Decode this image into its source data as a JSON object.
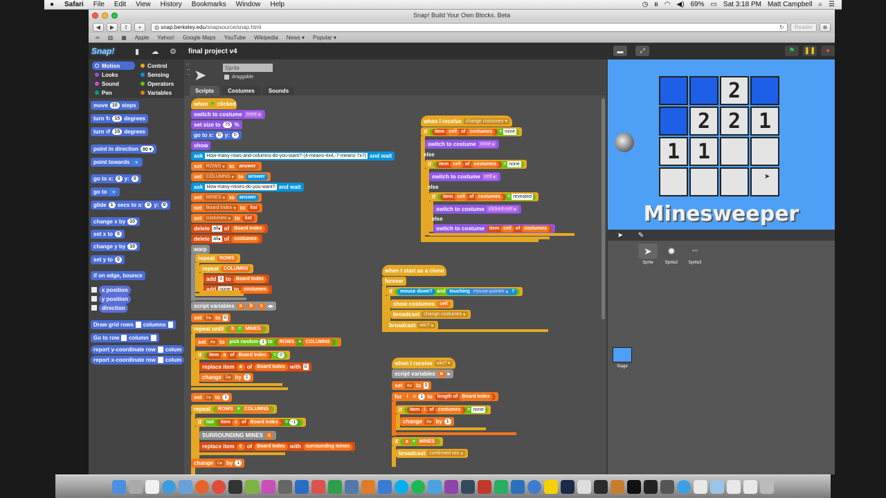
{
  "menubar": {
    "apple": "",
    "app": "Safari",
    "items": [
      "File",
      "Edit",
      "View",
      "History",
      "Bookmarks",
      "Window",
      "Help"
    ],
    "battery": "69%",
    "clock": "Sat 3:18 PM",
    "user": "Matt Campbell"
  },
  "window": {
    "title": "Snap! Build Your Own Blocks. Beta",
    "url_host": "snap.berkeley.edu",
    "url_path": "/snapsource/snap.html",
    "reader": "Reader",
    "bookmarks": [
      "Apple",
      "Yahoo!",
      "Google Maps",
      "YouTube",
      "Wikipedia",
      "News ▾",
      "Popular ▾"
    ]
  },
  "snap": {
    "logo": "Snap!",
    "project_title": "final project v4",
    "categories": [
      {
        "label": "Motion",
        "color": "#4a6cd4"
      },
      {
        "label": "Control",
        "color": "#e6a822"
      },
      {
        "label": "Looks",
        "color": "#8f56e3"
      },
      {
        "label": "Sensing",
        "color": "#0494dc"
      },
      {
        "label": "Sound",
        "color": "#cf4ad9"
      },
      {
        "label": "Operators",
        "color": "#62c213"
      },
      {
        "label": "Pen",
        "color": "#00a178"
      },
      {
        "label": "Variables",
        "color": "#f3761d"
      }
    ],
    "palette": {
      "move": "move",
      "move_n": "10",
      "steps": "steps",
      "turn_cw": "turn ↻",
      "turn_ccw": "turn ↺",
      "turn_n": "15",
      "degrees": "degrees",
      "point_dir": "point in direction",
      "point_dir_n": "90 ▾",
      "point_towards": "point towards",
      "goto_xy": "go to x:",
      "y": "y:",
      "zero": "0",
      "goto": "go to",
      "glide": "glide",
      "glide_n": "1",
      "secs_to_x": "secs to x:",
      "change_x": "change x by",
      "set_x": "set x to",
      "change_y": "change y by",
      "set_y": "set y to",
      "ten": "10",
      "bounce": "if on edge, bounce",
      "x_pos": "x position",
      "y_pos": "y position",
      "direction": "direction",
      "draw_grid": "Draw grid rows",
      "columns": "columns",
      "goto_row": "Go to row",
      "column": "column",
      "report_y": "report y-coordinate row",
      "report_x": "report x-coordinate row",
      "colum": "colum"
    },
    "sprite": {
      "name": "Sprite",
      "draggable": "draggable",
      "tabs": [
        "Scripts",
        "Costumes",
        "Sounds"
      ]
    },
    "script1": {
      "hat": "when",
      "hat2": "clicked",
      "switch_costume": "switch to costume",
      "mine": "mine",
      "set_size": "set size to",
      "size_n": "75",
      "pct": "%",
      "goto_x": "go to x:",
      "go_y": "y:",
      "zero": "0",
      "show": "show",
      "ask": "ask",
      "ask_rows": "How-many-rows-and-columns-do-you-want?-(4-means-4x4,-7-means-7x7)",
      "and_wait": "and wait",
      "set": "set",
      "to": "to",
      "rows": "ROWS",
      "columns": "COLUMNS",
      "mines": "MINES",
      "answer": "answer",
      "ask_mines": "How-many-mines-do-you-want?",
      "board_index": "Board Index",
      "costumes": "costumes",
      "list": "list",
      "delete": "delete",
      "all": "all",
      "of": "of",
      "warp": "warp",
      "repeat": "repeat",
      "add": "add",
      "add_zero": "0",
      "none": "none",
      "script_vars": "script variables",
      "a": "a",
      "b": "b",
      "c": "c",
      "repeat_until": "repeat until",
      "eq": "=",
      "pick_random": "pick random",
      "one": "1",
      "x": "×",
      "if": "if",
      "item": "item",
      "replace_item": "replace item",
      "with": "with",
      "zero_b": "0",
      "change": "change",
      "by": "by",
      "not": "not",
      "neg_one": "-1",
      "surrounding_mines": "SURROUNDING MINES",
      "surrounding_mines_l": "surrounding mines"
    },
    "script2": {
      "hat": "when I receive",
      "msg": "change costumes",
      "if": "if",
      "item": "item",
      "cell": "cell",
      "of": "of",
      "costumes": "costumes",
      "eq": "=",
      "mine": "mine",
      "else": "else",
      "switch": "switch to costume",
      "none": "none",
      "revealed": "revealed",
      "clicked_cell": "clicked-cell"
    },
    "script3": {
      "hat": "when I start as a clone",
      "forever": "forever",
      "if": "if",
      "mouse_down": "mouse down?",
      "and": "and",
      "touching": "touching",
      "mouse_pointer": "mouse-pointer",
      "q": "?",
      "show_costumes": "show costumes",
      "cell": "cell",
      "broadcast": "broadcast",
      "change_costumes": "change costumes",
      "win": "win?"
    },
    "script4": {
      "hat": "when I receive",
      "msg": "win?",
      "script_vars": "script variables",
      "a": "a",
      "set": "set",
      "to": "to",
      "zero": "0",
      "for": "for",
      "i": "i",
      "one": "1",
      "length_of": "length of",
      "board_index": "Board Index",
      "if": "if",
      "item": "item",
      "of": "of",
      "costumes": "costumes",
      "eq": "=",
      "none": "none",
      "change": "change",
      "by": "by",
      "mines": "MINES",
      "broadcast": "broadcast",
      "confirmed_win": "confirmed win"
    },
    "stage": {
      "title": "Minesweeper",
      "board": [
        [
          "mine",
          "mine",
          "2",
          "mine"
        ],
        [
          "mine",
          "2",
          "2",
          "1"
        ],
        [
          "1",
          "1",
          "",
          ""
        ],
        [
          "",
          "",
          "",
          ""
        ]
      ]
    },
    "corral": {
      "sprites": [
        "Sprite",
        "Sprite2",
        "Sprite3"
      ],
      "stage_label": "Stage"
    }
  }
}
